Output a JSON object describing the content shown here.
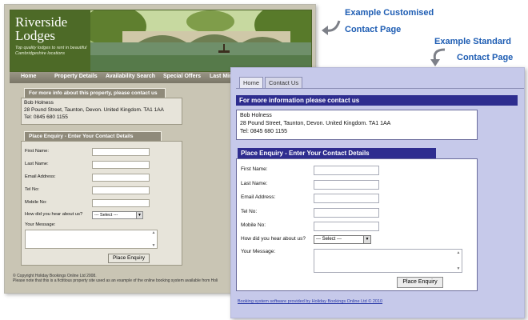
{
  "callouts": {
    "custom_line1": "Example Customised",
    "custom_line2": "Contact Page",
    "standard_line1": "Example Standard",
    "standard_line2": "Contact Page"
  },
  "custom": {
    "brand": {
      "name_line1": "Riverside",
      "name_line2": "Lodges",
      "tagline": "Top quality lodges to rent in beautiful Cambridgeshire locations"
    },
    "nav": [
      "Home",
      "Property Details",
      "Availability Search",
      "Special Offers",
      "Last Minute"
    ],
    "info_header": "For more info about this property, please contact us",
    "contact": {
      "name": "Bob Holness",
      "address": "28 Pound Street, Taunton, Devon.  United Kingdom.  TA1 1AA",
      "tel": "Tel: 0845 680 1155"
    },
    "enquiry_header": "Place Enquiry - Enter Your Contact Details",
    "fields": [
      "First Name:",
      "Last Name:",
      "Email Address:",
      "Tel No:",
      "Mobile No:"
    ],
    "hear_label": "How did you hear about us?",
    "select_value": "--- Select ---",
    "message_label": "Your Message:",
    "submit": "Place Enquiry",
    "footer_line1": "© Copyright Holiday Bookings Online Ltd 2008.",
    "footer_line2": "Please note that this is a fictitious property site used as an example of the online booking system available from Holi"
  },
  "standard": {
    "tabs": [
      "Home",
      "Contact Us"
    ],
    "info_header": "For more information please contact us",
    "contact": {
      "name": "Bob Holness",
      "address": "28 Pound Street, Taunton, Devon.  United Kingdom.  TA1 1AA",
      "tel": "Tel: 0845 680 1155"
    },
    "enquiry_header": "Place Enquiry - Enter Your Contact Details",
    "fields": [
      "First Name:",
      "Last Name:",
      "Email Address:",
      "Tel No:",
      "Mobile No:"
    ],
    "hear_label": "How did you hear about us?",
    "select_value": "--- Select ---",
    "message_label": "Your Message:",
    "submit": "Place Enquiry",
    "footer": "Booking system software provided by Holiday Bookings Online Ltd © 2010"
  },
  "colors": {
    "callout": "#1e5db3",
    "standard_header": "#2e2d8f",
    "custom_banner": "#6d8a3c"
  },
  "icons": {
    "callout_arrow": "curved-arrow-icon",
    "scroll_up": "scroll-up-icon",
    "scroll_down": "scroll-down-icon"
  }
}
